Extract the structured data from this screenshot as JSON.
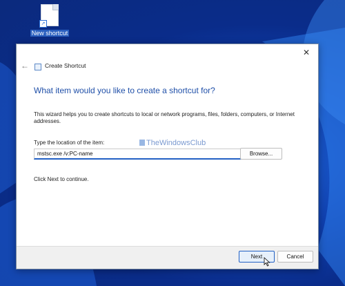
{
  "desktop": {
    "shortcut_label": "New shortcut"
  },
  "dialog": {
    "title": "Create Shortcut",
    "heading": "What item would you like to create a shortcut for?",
    "description": "This wizard helps you to create shortcuts to local or network programs, files, folders, computers, or Internet addresses.",
    "field_label": "Type the location of the item:",
    "location_value": "mstsc.exe /v:PC-name",
    "browse_label": "Browse...",
    "hint": "Click Next to continue.",
    "watermark": "TheWindowsClub",
    "next_label": "Next",
    "cancel_label": "Cancel"
  },
  "colors": {
    "accent": "#2160c4",
    "heading": "#1f4fa8",
    "wallpaper": "#0f3fae"
  },
  "icons": {
    "close": "close-icon",
    "back": "back-arrow-icon",
    "shortcut": "shortcut-file-icon"
  }
}
